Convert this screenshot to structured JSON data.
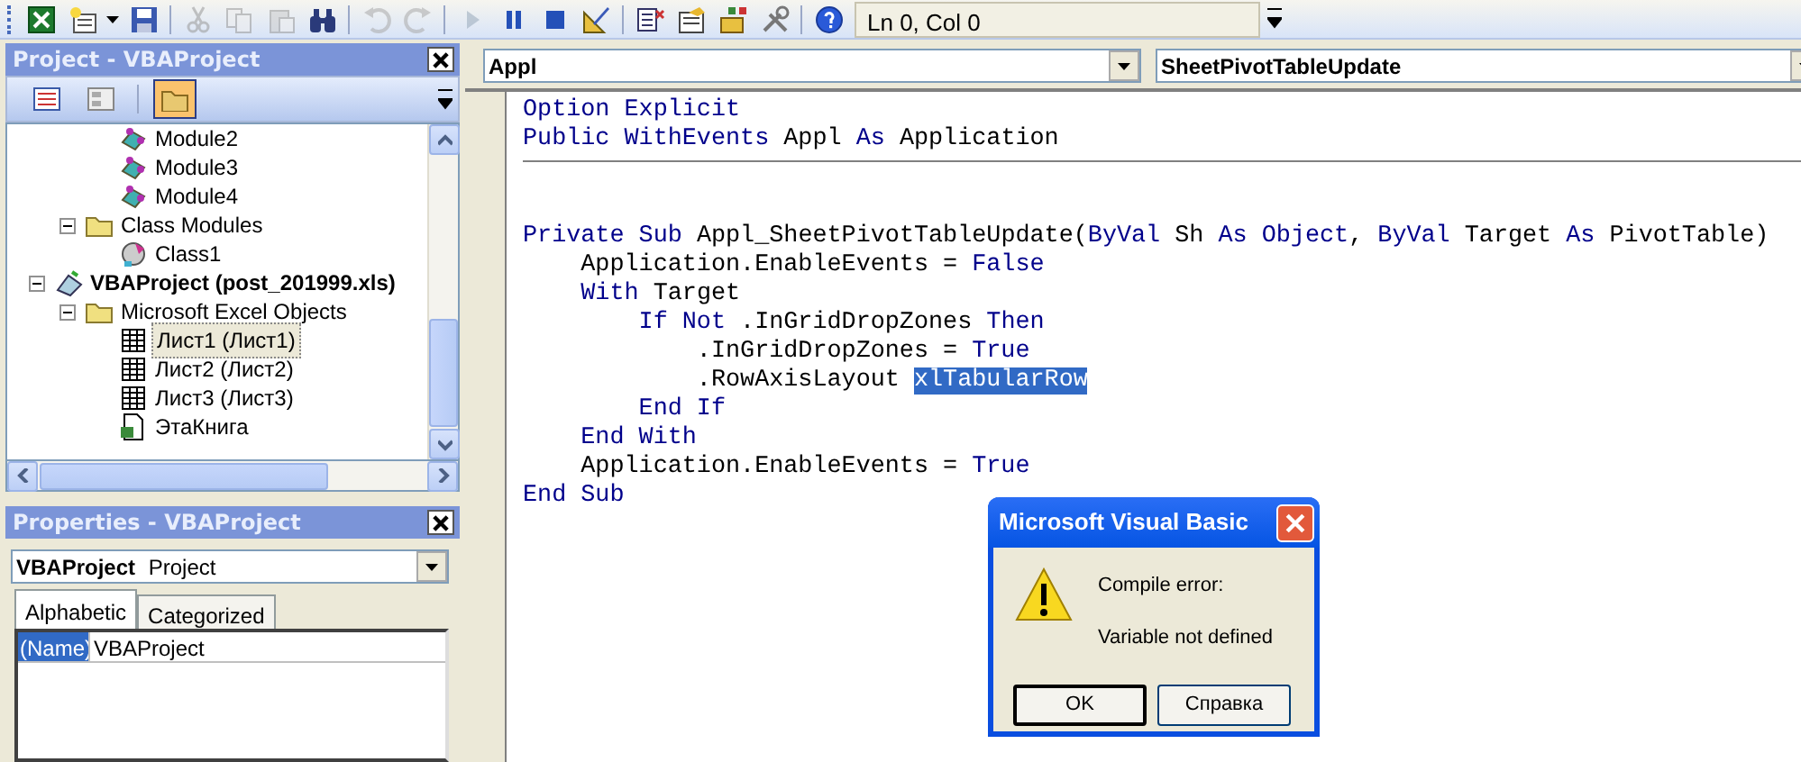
{
  "toolbar": {
    "buttons": [
      {
        "kind": "excel",
        "disabled": false
      },
      {
        "kind": "insert",
        "disabled": false
      },
      {
        "kind": "dropdown",
        "disabled": false
      },
      {
        "kind": "save",
        "disabled": false
      },
      {
        "kind": "sep"
      },
      {
        "kind": "cut",
        "disabled": true
      },
      {
        "kind": "copy",
        "disabled": true
      },
      {
        "kind": "paste",
        "disabled": true
      },
      {
        "kind": "find",
        "disabled": false
      },
      {
        "kind": "sep"
      },
      {
        "kind": "undo",
        "disabled": true
      },
      {
        "kind": "redo",
        "disabled": true
      },
      {
        "kind": "sep"
      },
      {
        "kind": "run",
        "disabled": true
      },
      {
        "kind": "pause",
        "disabled": false
      },
      {
        "kind": "stop",
        "disabled": false
      },
      {
        "kind": "design",
        "disabled": false
      },
      {
        "kind": "sep"
      },
      {
        "kind": "project",
        "disabled": false
      },
      {
        "kind": "properties",
        "disabled": false
      },
      {
        "kind": "browser",
        "disabled": false
      },
      {
        "kind": "toolbox",
        "disabled": false
      },
      {
        "kind": "sep"
      },
      {
        "kind": "help",
        "disabled": false
      }
    ],
    "position": "Ln 0, Col 0"
  },
  "project_explorer": {
    "title": "Project - VBAProject",
    "view_buttons": [
      {
        "kind": "code",
        "selected": false
      },
      {
        "kind": "object",
        "selected": false
      },
      {
        "kind": "folders",
        "selected": true
      }
    ],
    "tree": [
      {
        "children": [
          {
            "children": [
              {
                "label": "Module2",
                "kind": "module",
                "selected": false
              },
              {
                "label": "Module3",
                "kind": "module",
                "selected": false
              },
              {
                "label": "Module4",
                "kind": "module",
                "selected": false
              }
            ]
          },
          {
            "label": "Class Modules",
            "kind": "folder",
            "expanded": true,
            "selected": false,
            "children": [
              {
                "label": "Class1",
                "kind": "class",
                "selected": false
              }
            ]
          }
        ]
      },
      {
        "label": "VBAProject (post_201999.xls)",
        "kind": "project",
        "expanded": true,
        "selected": false,
        "children": [
          {
            "label": "Microsoft Excel Objects",
            "kind": "folder",
            "expanded": true,
            "selected": false,
            "children": [
              {
                "label": "Лист1 (Лист1)",
                "kind": "sheet",
                "selected": true
              },
              {
                "label": "Лист2 (Лист2)",
                "kind": "sheet",
                "selected": false
              },
              {
                "label": "Лист3 (Лист3)",
                "kind": "sheet",
                "selected": false
              },
              {
                "label": "ЭтаКнига",
                "kind": "workbook",
                "selected": false
              }
            ]
          }
        ]
      }
    ]
  },
  "properties": {
    "title": "Properties - VBAProject",
    "object": {
      "name": "VBAProject",
      "type": "Project"
    },
    "tabs": [
      {
        "label": "Alphabetic",
        "selected": true
      },
      {
        "label": "Categorized",
        "selected": false
      }
    ],
    "rows": [
      {
        "name": "(Name)",
        "value": "VBAProject",
        "selected": true
      }
    ]
  },
  "code_window": {
    "object": "Appl",
    "procedure": "SheetPivotTableUpdate",
    "procedures": [
      {
        "lines": [
          [
            {
              "text": "Option Explicit",
              "kind": "keyword"
            }
          ],
          [
            {
              "text": "Public WithEvents",
              "kind": "keyword"
            },
            {
              "text": " Appl ",
              "kind": "plain"
            },
            {
              "text": "As",
              "kind": "keyword"
            },
            {
              "text": " Application",
              "kind": "plain"
            }
          ]
        ]
      },
      {
        "lines": [
          [
            {
              "text": "Private Sub",
              "kind": "keyword"
            },
            {
              "text": " Appl_SheetPivotTableUpdate(",
              "kind": "plain"
            },
            {
              "text": "ByVal",
              "kind": "keyword"
            },
            {
              "text": " Sh ",
              "kind": "plain"
            },
            {
              "text": "As Object",
              "kind": "keyword"
            },
            {
              "text": ", ",
              "kind": "plain"
            },
            {
              "text": "ByVal",
              "kind": "keyword"
            },
            {
              "text": " Target ",
              "kind": "plain"
            },
            {
              "text": "As",
              "kind": "keyword"
            },
            {
              "text": " PivotTable)",
              "kind": "plain"
            }
          ],
          [
            {
              "text": "    Application.EnableEvents = ",
              "kind": "plain"
            },
            {
              "text": "False",
              "kind": "keyword"
            }
          ],
          [
            {
              "text": "    With",
              "kind": "keyword"
            },
            {
              "text": " Target",
              "kind": "plain"
            }
          ],
          [
            {
              "text": "        If Not",
              "kind": "keyword"
            },
            {
              "text": " .InGridDropZones ",
              "kind": "plain"
            },
            {
              "text": "Then",
              "kind": "keyword"
            }
          ],
          [
            {
              "text": "            .InGridDropZones = ",
              "kind": "plain"
            },
            {
              "text": "True",
              "kind": "keyword"
            }
          ],
          [
            {
              "text": "            .RowAxisLayout ",
              "kind": "plain"
            },
            {
              "text": "xlTabularRow",
              "kind": "selected"
            }
          ],
          [
            {
              "text": "        End If",
              "kind": "keyword"
            }
          ],
          [
            {
              "text": "    End With",
              "kind": "keyword"
            }
          ],
          [
            {
              "text": "    Application.EnableEvents = ",
              "kind": "plain"
            },
            {
              "text": "True",
              "kind": "keyword"
            }
          ],
          [
            {
              "text": "End Sub",
              "kind": "keyword"
            }
          ]
        ]
      }
    ]
  },
  "dialog": {
    "title": "Microsoft Visual Basic",
    "messages": [
      "Compile error:",
      "Variable not defined"
    ],
    "buttons": [
      "OK",
      "Справка"
    ]
  }
}
